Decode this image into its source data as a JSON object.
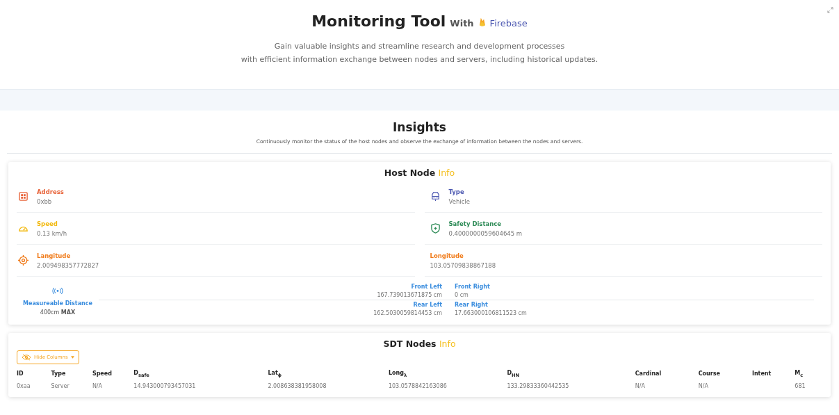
{
  "header": {
    "title": "Monitoring Tool",
    "with": "With",
    "brand": "Firebase",
    "subtitle_lines": [
      "Gain valuable insights and streamline research and development processes",
      "with efficient information exchange between nodes and servers, including historical updates."
    ]
  },
  "insights": {
    "title": "Insights",
    "description": "Continuously monitor the status of the host nodes and observe the exchange of information between the nodes and servers."
  },
  "host_node": {
    "title": "Host Node",
    "badge": "Info",
    "fields": [
      {
        "kind": "chip",
        "label": "Address",
        "value": "0xbb",
        "color": "#e8663d"
      },
      {
        "kind": "vehicle",
        "label": "Type",
        "value": "Vehicle",
        "color": "#4a56b0"
      },
      {
        "kind": "gauge",
        "label": "Speed",
        "value": "0.13 km/h",
        "color": "#f2b90f"
      },
      {
        "kind": "shield",
        "label": "Safety Distance",
        "value": "0.4000000059604645 m",
        "color": "#2e8b57"
      },
      {
        "kind": "target",
        "label": "Langitude",
        "value": "2.009498357772827",
        "color": "#f07b1a"
      },
      {
        "kind": "plain",
        "label": "Longitude",
        "value": "103.05709838867188",
        "color": "#f07b1a"
      }
    ],
    "measurable": {
      "label": "Measureable Distance",
      "value": "400cm",
      "suffix": "MAX"
    },
    "sensors": [
      {
        "label": "Front Left",
        "value": "167.739013671875 cm"
      },
      {
        "label": "Front Right",
        "value": "0 cm"
      },
      {
        "label": "Rear Left",
        "value": "162.5030059814453 cm"
      },
      {
        "label": "Rear Right",
        "value": "17.663000106811523 cm"
      }
    ]
  },
  "sdt_nodes": {
    "title": "SDT Nodes",
    "badge": "Info",
    "hide_columns": "Hide Columns",
    "columns": [
      "ID",
      "Type",
      "Speed",
      "D$_{safe}$",
      "Lat$_{ϕ}$",
      "Long$_{λ}$",
      "D$_{HN}$",
      "Cardinal",
      "Course",
      "Intent",
      "M$_{c}$"
    ],
    "rows": [
      [
        "0xaa",
        "Server",
        "N/A",
        "14.943000793457031",
        "2.008638381958008",
        "103.0578842163086",
        "133.29833360442535",
        "N/A",
        "N/A",
        "",
        "681"
      ]
    ]
  }
}
